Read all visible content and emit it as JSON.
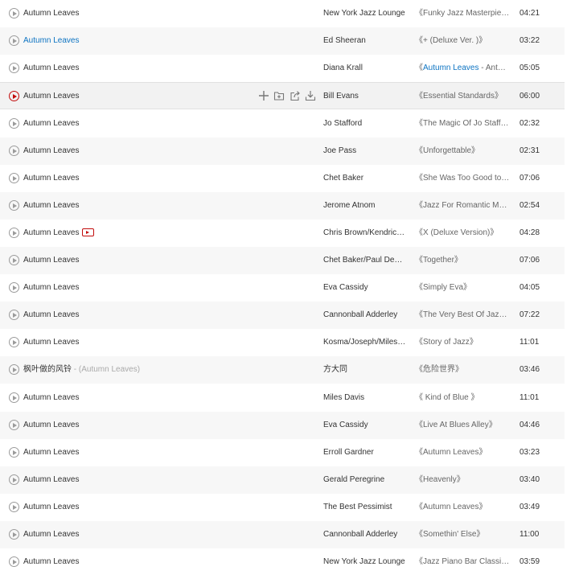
{
  "colors": {
    "accent_red": "#c20c0c",
    "link_blue": "#0c73c2",
    "stripe": "#f7f7f7",
    "hover": "#f2f2f2"
  },
  "hover_icons": [
    "add-icon",
    "add-to-folder-icon",
    "share-icon",
    "download-icon"
  ],
  "songs": [
    {
      "title": "Autumn Leaves",
      "artist": "New York Jazz Lounge",
      "album_open": "《",
      "album": "Funky Jazz Masterpieces",
      "album_close": "》",
      "duration": "04:21"
    },
    {
      "title": "Autumn Leaves",
      "title_highlight": true,
      "artist": "Ed Sheeran",
      "album_open": "《",
      "album": "+ (Deluxe Ver. )",
      "album_close": "》",
      "duration": "03:22"
    },
    {
      "title": "Autumn Leaves",
      "artist": "Diana Krall",
      "album_open": "《",
      "album_highlight": "Autumn Leaves",
      "album": " - Anthology",
      "album_close": "》",
      "duration": "05:05"
    },
    {
      "title": "Autumn Leaves",
      "active": true,
      "artist": "Bill Evans",
      "album_open": "《",
      "album": "Essential Standards",
      "album_close": "》",
      "duration": "06:00"
    },
    {
      "title": "Autumn Leaves",
      "artist": "Jo Stafford",
      "album_open": "《",
      "album": "The Magic Of Jo Stafford",
      "album_close": "》",
      "duration": "02:32"
    },
    {
      "title": "Autumn Leaves",
      "artist": "Joe Pass",
      "album_open": "《",
      "album": "Unforgettable",
      "album_close": "》",
      "duration": "02:31"
    },
    {
      "title": "Autumn Leaves",
      "artist": "Chet Baker",
      "album_open": "《",
      "album": "She Was Too Good to Me",
      "album_close": "》",
      "duration": "07:06"
    },
    {
      "title": "Autumn Leaves",
      "artist": "Jerome Atnom",
      "album_open": "《",
      "album": "Jazz For Romantic Moments",
      "album_close": "》",
      "duration": "02:54"
    },
    {
      "title": "Autumn Leaves",
      "has_mv": true,
      "artist": "Chris Brown/Kendrick Lamar",
      "album_open": "《",
      "album": "X (Deluxe Version)",
      "album_close": "》",
      "duration": "04:28"
    },
    {
      "title": "Autumn Leaves",
      "artist": "Chet Baker/Paul Desmond",
      "album_open": "《",
      "album": "Together",
      "album_close": "》",
      "duration": "07:06"
    },
    {
      "title": "Autumn Leaves",
      "artist": "Eva Cassidy",
      "album_open": "《",
      "album": "Simply Eva",
      "album_close": "》",
      "duration": "04:05"
    },
    {
      "title": "Autumn Leaves",
      "artist": "Cannonball Adderley",
      "album_open": "《",
      "album": "The Very Best Of Jazz",
      "album_close": "》",
      "duration": "07:22"
    },
    {
      "title": "Autumn Leaves",
      "artist": "Kosma/Joseph/Miles Davis",
      "album_open": "《",
      "album": "Story of Jazz",
      "album_close": "》",
      "duration": "11:01"
    },
    {
      "title": "枫叶做的风铃",
      "alias": " - (Autumn Leaves)",
      "artist": "方大同",
      "album_open": "《",
      "album": "危险世界",
      "album_close": "》",
      "duration": "03:46"
    },
    {
      "title": "Autumn Leaves",
      "artist": "Miles Davis",
      "album_open": "《",
      "album": " Kind of Blue ",
      "album_close": "》",
      "duration": "11:01"
    },
    {
      "title": "Autumn Leaves",
      "artist": "Eva Cassidy",
      "album_open": "《",
      "album": "Live At Blues Alley",
      "album_close": "》",
      "duration": "04:46"
    },
    {
      "title": "Autumn Leaves",
      "artist": "Erroll Gardner",
      "album_open": "《",
      "album": "Autumn Leaves",
      "album_close": "》",
      "duration": "03:23"
    },
    {
      "title": "Autumn Leaves",
      "artist": "Gerald Peregrine",
      "album_open": "《",
      "album": "Heavenly",
      "album_close": "》",
      "duration": "03:40"
    },
    {
      "title": "Autumn Leaves",
      "artist": "The Best Pessimist",
      "album_open": "《",
      "album": "Autumn Leaves",
      "album_close": "》",
      "duration": "03:49"
    },
    {
      "title": "Autumn Leaves",
      "artist": "Cannonball Adderley",
      "album_open": "《",
      "album": "Somethin' Else",
      "album_close": "》",
      "duration": "11:00"
    },
    {
      "title": "Autumn Leaves",
      "artist": "New York Jazz Lounge",
      "album_open": "《",
      "album": "Jazz Piano Bar Classics",
      "album_close": "》",
      "duration": "03:59"
    }
  ]
}
